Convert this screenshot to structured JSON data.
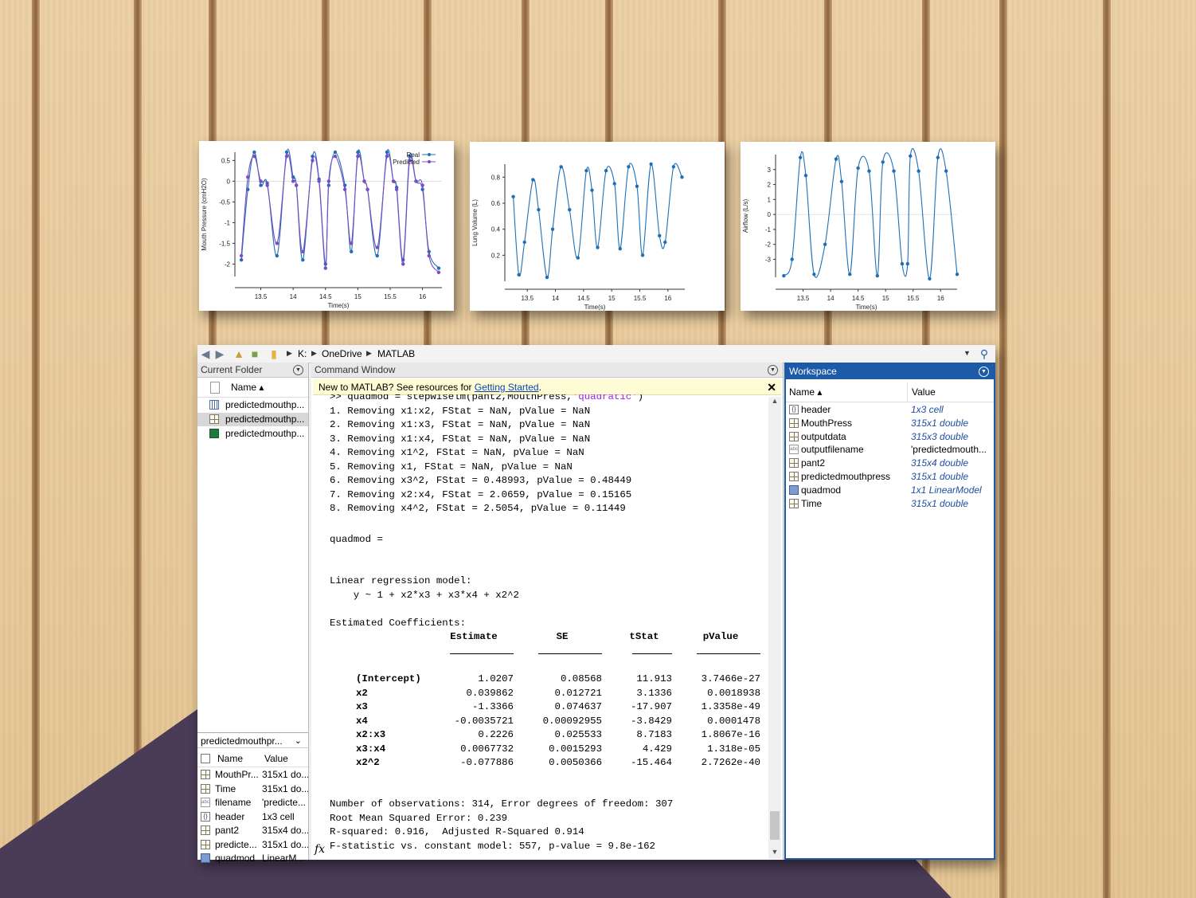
{
  "colors": {
    "wood": "#e9c99a",
    "purple_shape": "#4a3b56",
    "workspace_blue": "#1d5aa8",
    "real_line": "#1f6fb5",
    "predicted_line": "#7b4cc4"
  },
  "chart_data": [
    {
      "type": "line",
      "xlabel": "Time(s)",
      "ylabel": "Mouth Pressure (cmH2O)",
      "x_ticks": [
        "13.5",
        "14",
        "14.5",
        "15",
        "15.5",
        "16"
      ],
      "y_ticks": [
        "0.5",
        "0",
        "-0.5",
        "-1",
        "-1.5",
        "-2"
      ],
      "xlim": [
        13.1,
        16.3
      ],
      "ylim": [
        -2.3,
        0.7
      ],
      "legend": [
        "Real",
        "Predicted"
      ],
      "legend_position": "top-right",
      "series": [
        {
          "name": "Real",
          "x": [
            13.2,
            13.3,
            13.4,
            13.5,
            13.6,
            13.75,
            13.9,
            14.0,
            14.05,
            14.15,
            14.3,
            14.4,
            14.5,
            14.55,
            14.65,
            14.8,
            14.9,
            15.0,
            15.1,
            15.15,
            15.3,
            15.45,
            15.55,
            15.6,
            15.7,
            15.8,
            15.9,
            16.0,
            16.1,
            16.25
          ],
          "y": [
            -1.9,
            -0.2,
            0.7,
            -0.1,
            -0.05,
            -1.8,
            0.7,
            0.1,
            -0.1,
            -1.9,
            0.6,
            0.05,
            -2.0,
            -0.1,
            0.7,
            -0.1,
            -1.7,
            0.7,
            0.0,
            -0.2,
            -1.8,
            0.7,
            0.0,
            -0.15,
            -1.9,
            0.6,
            0.0,
            -0.2,
            -1.7,
            -2.1
          ]
        },
        {
          "name": "Predicted",
          "x": [
            13.2,
            13.3,
            13.4,
            13.5,
            13.6,
            13.75,
            13.9,
            14.0,
            14.05,
            14.15,
            14.3,
            14.4,
            14.5,
            14.55,
            14.65,
            14.8,
            14.9,
            15.0,
            15.1,
            15.15,
            15.3,
            15.45,
            15.55,
            15.6,
            15.7,
            15.8,
            15.9,
            16.0,
            16.1,
            16.25
          ],
          "y": [
            -1.8,
            0.1,
            0.6,
            0.0,
            -0.1,
            -1.5,
            0.6,
            0.0,
            -0.1,
            -1.7,
            0.5,
            0.0,
            -2.1,
            0.0,
            0.6,
            -0.2,
            -1.5,
            0.6,
            0.0,
            -0.2,
            -1.6,
            0.6,
            0.0,
            -0.2,
            -2.0,
            0.5,
            0.0,
            -0.1,
            -1.8,
            -2.2
          ]
        }
      ]
    },
    {
      "type": "line",
      "xlabel": "Time(s)",
      "ylabel": "Lung Volume (L)",
      "x_ticks": [
        "13.5",
        "14",
        "14.5",
        "15",
        "15.5",
        "16"
      ],
      "y_ticks": [
        "0.8",
        "0.6",
        "0.4",
        "0.2"
      ],
      "xlim": [
        13.1,
        16.3
      ],
      "ylim": [
        0.0,
        0.9
      ],
      "series": [
        {
          "name": "",
          "x": [
            13.25,
            13.35,
            13.45,
            13.6,
            13.7,
            13.85,
            13.95,
            14.1,
            14.25,
            14.4,
            14.55,
            14.65,
            14.75,
            14.9,
            15.05,
            15.15,
            15.3,
            15.45,
            15.55,
            15.7,
            15.85,
            15.95,
            16.1,
            16.25
          ],
          "y": [
            0.65,
            0.05,
            0.3,
            0.78,
            0.55,
            0.03,
            0.4,
            0.88,
            0.55,
            0.18,
            0.85,
            0.7,
            0.26,
            0.85,
            0.75,
            0.25,
            0.88,
            0.73,
            0.2,
            0.9,
            0.35,
            0.3,
            0.88,
            0.8
          ]
        }
      ]
    },
    {
      "type": "line",
      "xlabel": "Time(s)",
      "ylabel": "Airflow (L/s)",
      "x_ticks": [
        "13.5",
        "14",
        "14.5",
        "15",
        "15.5",
        "16"
      ],
      "y_ticks": [
        "3",
        "2",
        "1",
        "0",
        "-1",
        "-2",
        "-3"
      ],
      "xlim": [
        13.0,
        16.3
      ],
      "ylim": [
        -4.2,
        4.0
      ],
      "series": [
        {
          "name": "",
          "x": [
            13.15,
            13.3,
            13.45,
            13.55,
            13.7,
            13.9,
            14.1,
            14.2,
            14.35,
            14.5,
            14.7,
            14.85,
            14.95,
            15.15,
            15.3,
            15.4,
            15.45,
            15.6,
            15.8,
            15.95,
            16.1,
            16.3
          ],
          "y": [
            -4.1,
            -3.0,
            3.8,
            2.6,
            -4.0,
            -2.0,
            3.7,
            2.2,
            -4.0,
            3.1,
            2.9,
            -4.1,
            3.5,
            2.9,
            -3.3,
            -3.3,
            3.9,
            2.9,
            -4.3,
            3.8,
            2.9,
            -4.0
          ]
        }
      ]
    }
  ],
  "toolbar": {
    "path": [
      "K:",
      "OneDrive",
      "MATLAB"
    ]
  },
  "current_folder": {
    "title": "Current Folder",
    "col_name": "Name ▴",
    "files": [
      {
        "name": "predictedmouthp...",
        "icon": "mat-file-icon"
      },
      {
        "name": "predictedmouthp...",
        "icon": "table-icon"
      },
      {
        "name": "predictedmouthp...",
        "icon": "excel-file-icon"
      }
    ],
    "detail_title": "predictedmouthpr...",
    "detail_cols": [
      "Name",
      "Value"
    ],
    "detail_rows": [
      {
        "name": "MouthPr...",
        "value": "315x1 do...",
        "icon": "grid"
      },
      {
        "name": "Time",
        "value": "315x1 do...",
        "icon": "grid"
      },
      {
        "name": "filename",
        "value": "'predicte...",
        "icon": "abc"
      },
      {
        "name": "header",
        "value": "1x3 cell",
        "icon": "cell"
      },
      {
        "name": "pant2",
        "value": "315x4 do...",
        "icon": "grid"
      },
      {
        "name": "predicte...",
        "value": "315x1 do...",
        "icon": "grid"
      },
      {
        "name": "quadmod",
        "value": "LinearM...",
        "icon": "obj"
      }
    ]
  },
  "command_window": {
    "title": "Command Window",
    "banner_text": "New to MATLAB? See resources for ",
    "banner_link": "Getting Started",
    "banner_end": ".",
    "close": "✕",
    "cmd_prefix": ">> quadmod = stepwiselm(pant2,MouthPress,",
    "cmd_string": "'quadratic'",
    "cmd_suffix": ")",
    "steps": [
      "1. Removing x1:x2, FStat = NaN, pValue = NaN",
      "2. Removing x1:x3, FStat = NaN, pValue = NaN",
      "3. Removing x1:x4, FStat = NaN, pValue = NaN",
      "4. Removing x1^2, FStat = NaN, pValue = NaN",
      "5. Removing x1, FStat = NaN, pValue = NaN",
      "6. Removing x3^2, FStat = 0.48993, pValue = 0.48449",
      "7. Removing x2:x4, FStat = 2.0659, pValue = 0.15165",
      "8. Removing x4^2, FStat = 2.5054, pValue = 0.11449"
    ],
    "result_name": "quadmod =",
    "model_type": "Linear regression model:",
    "formula": "    y ~ 1 + x2*x3 + x3*x4 + x2^2",
    "coef_heading": "Estimated Coefficients:",
    "coef_cols": [
      "Estimate",
      "SE",
      "tStat",
      "pValue"
    ],
    "coef_rows": [
      {
        "name": "(Intercept)",
        "estimate": "1.0207",
        "se": "0.08568",
        "tstat": "11.913",
        "pvalue": "3.7466e-27"
      },
      {
        "name": "x2",
        "estimate": "0.039862",
        "se": "0.012721",
        "tstat": "3.1336",
        "pvalue": "0.0018938"
      },
      {
        "name": "x3",
        "estimate": "-1.3366",
        "se": "0.074637",
        "tstat": "-17.907",
        "pvalue": "1.3358e-49"
      },
      {
        "name": "x4",
        "estimate": "-0.0035721",
        "se": "0.00092955",
        "tstat": "-3.8429",
        "pvalue": "0.0001478"
      },
      {
        "name": "x2:x3",
        "estimate": "0.2226",
        "se": "0.025533",
        "tstat": "8.7183",
        "pvalue": "1.8067e-16"
      },
      {
        "name": "x3:x4",
        "estimate": "0.0067732",
        "se": "0.0015293",
        "tstat": "4.429",
        "pvalue": "1.318e-05"
      },
      {
        "name": "x2^2",
        "estimate": "-0.077886",
        "se": "0.0050366",
        "tstat": "-15.464",
        "pvalue": "2.7262e-40"
      }
    ],
    "summary": [
      "Number of observations: 314, Error degrees of freedom: 307",
      "Root Mean Squared Error: 0.239",
      "R-squared: 0.916,  Adjusted R-Squared 0.914",
      "F-statistic vs. constant model: 557, p-value = 9.8e-162"
    ],
    "fx": "fx"
  },
  "workspace": {
    "title": "Workspace",
    "col_name": "Name ▴",
    "col_value": "Value",
    "rows": [
      {
        "name": "header",
        "value": "1x3 cell",
        "icon": "cell",
        "plain": false
      },
      {
        "name": "MouthPress",
        "value": "315x1 double",
        "icon": "grid",
        "plain": false
      },
      {
        "name": "outputdata",
        "value": "315x3 double",
        "icon": "grid",
        "plain": false
      },
      {
        "name": "outputfilename",
        "value": "'predictedmouth...",
        "icon": "abc",
        "plain": true
      },
      {
        "name": "pant2",
        "value": "315x4 double",
        "icon": "grid",
        "plain": false
      },
      {
        "name": "predictedmouthpress",
        "value": "315x1 double",
        "icon": "grid",
        "plain": false
      },
      {
        "name": "quadmod",
        "value": "1x1 LinearModel",
        "icon": "obj",
        "plain": false
      },
      {
        "name": "Time",
        "value": "315x1 double",
        "icon": "grid",
        "plain": false
      }
    ]
  }
}
